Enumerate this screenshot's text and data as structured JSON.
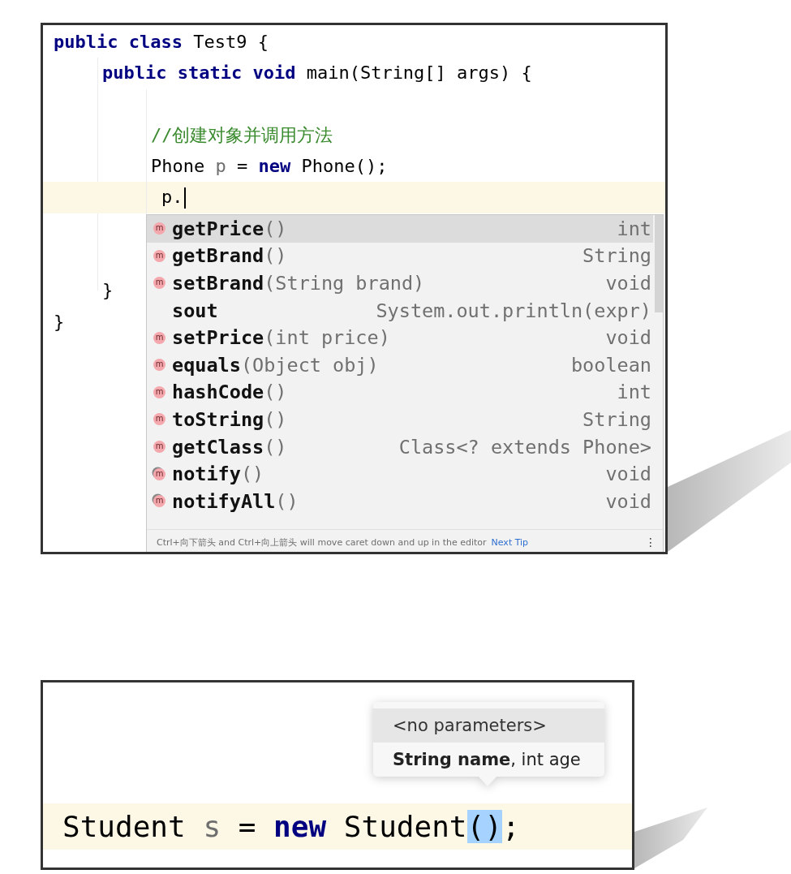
{
  "editor": {
    "code": [
      {
        "kind": "code",
        "tokens": [
          {
            "text": "public class",
            "kind": "keyword"
          },
          {
            "text": " Test9 {",
            "kind": "plain"
          }
        ],
        "children": [
          {
            "kind": "code",
            "tokens": [
              {
                "text": "public static void",
                "kind": "keyword"
              },
              {
                "text": " main(String[] args) {",
                "kind": "plain"
              }
            ],
            "children": [
              {
                "kind": "blank"
              },
              {
                "kind": "code",
                "tokens": [
                  {
                    "text": "//创建对象并调用方法",
                    "kind": "comment"
                  }
                ]
              },
              {
                "kind": "code",
                "tokens": [
                  {
                    "text": "Phone ",
                    "kind": "plain"
                  },
                  {
                    "text": "p",
                    "kind": "var"
                  },
                  {
                    "text": " = ",
                    "kind": "plain"
                  },
                  {
                    "text": "new",
                    "kind": "keyword"
                  },
                  {
                    "text": " Phone();",
                    "kind": "plain"
                  }
                ]
              },
              {
                "kind": "code",
                "current": true,
                "caret": true,
                "tokens": [
                  {
                    "text": "p.",
                    "kind": "plain"
                  }
                ]
              },
              {
                "kind": "blank"
              },
              {
                "kind": "blank"
              }
            ]
          },
          {
            "kind": "code",
            "tokens": [
              {
                "text": "}",
                "kind": "plain"
              }
            ]
          }
        ]
      },
      {
        "kind": "code",
        "tokens": [
          {
            "text": "}",
            "kind": "plain"
          }
        ]
      }
    ],
    "completion": {
      "items": [
        {
          "kind": "method",
          "icon": "m",
          "name": "getPrice",
          "params": "()",
          "type": "int",
          "selected": true
        },
        {
          "kind": "method",
          "icon": "m",
          "name": "getBrand",
          "params": "()",
          "type": "String",
          "selected": false
        },
        {
          "kind": "method",
          "icon": "m",
          "name": "setBrand",
          "params": "(String brand)",
          "type": "void",
          "selected": false
        },
        {
          "kind": "template",
          "name": "sout",
          "type": "System.out.println(expr)",
          "selected": false
        },
        {
          "kind": "method",
          "icon": "m",
          "name": "setPrice",
          "params": "(int price)",
          "type": "void",
          "selected": false
        },
        {
          "kind": "method",
          "icon": "m",
          "name": "equals",
          "params": "(Object obj)",
          "type": "boolean",
          "selected": false
        },
        {
          "kind": "method",
          "icon": "m",
          "name": "hashCode",
          "params": "()",
          "type": "int",
          "selected": false
        },
        {
          "kind": "method",
          "icon": "m",
          "name": "toString",
          "params": "()",
          "type": "String",
          "selected": false
        },
        {
          "kind": "method",
          "icon": "m",
          "name": "getClass",
          "params": "()",
          "type": "Class<? extends Phone>",
          "selected": false
        },
        {
          "kind": "inherited",
          "icon": "m",
          "name": "notify",
          "params": "()",
          "type": "void",
          "selected": false
        },
        {
          "kind": "inherited",
          "icon": "m",
          "name": "notifyAll",
          "params": "()",
          "type": "void",
          "selected": false
        }
      ],
      "hint": "Ctrl+向下箭头 and Ctrl+向上箭头 will move caret down and up in the editor",
      "next_tip": "Next Tip",
      "more": "⋮"
    }
  },
  "snippet": {
    "line": {
      "current": true,
      "tokens": [
        {
          "text": "Student ",
          "kind": "plain"
        },
        {
          "text": "s",
          "kind": "var"
        },
        {
          "text": " = ",
          "kind": "plain"
        },
        {
          "text": "new",
          "kind": "keyword"
        },
        {
          "text": " Student",
          "kind": "plain"
        },
        {
          "text": "()",
          "kind": "match"
        },
        {
          "text": ";",
          "kind": "plain"
        }
      ]
    },
    "parameter_info": [
      {
        "text": "<no parameters>",
        "selected": true
      },
      {
        "text": "**String name**, int age",
        "selected": false
      }
    ]
  }
}
